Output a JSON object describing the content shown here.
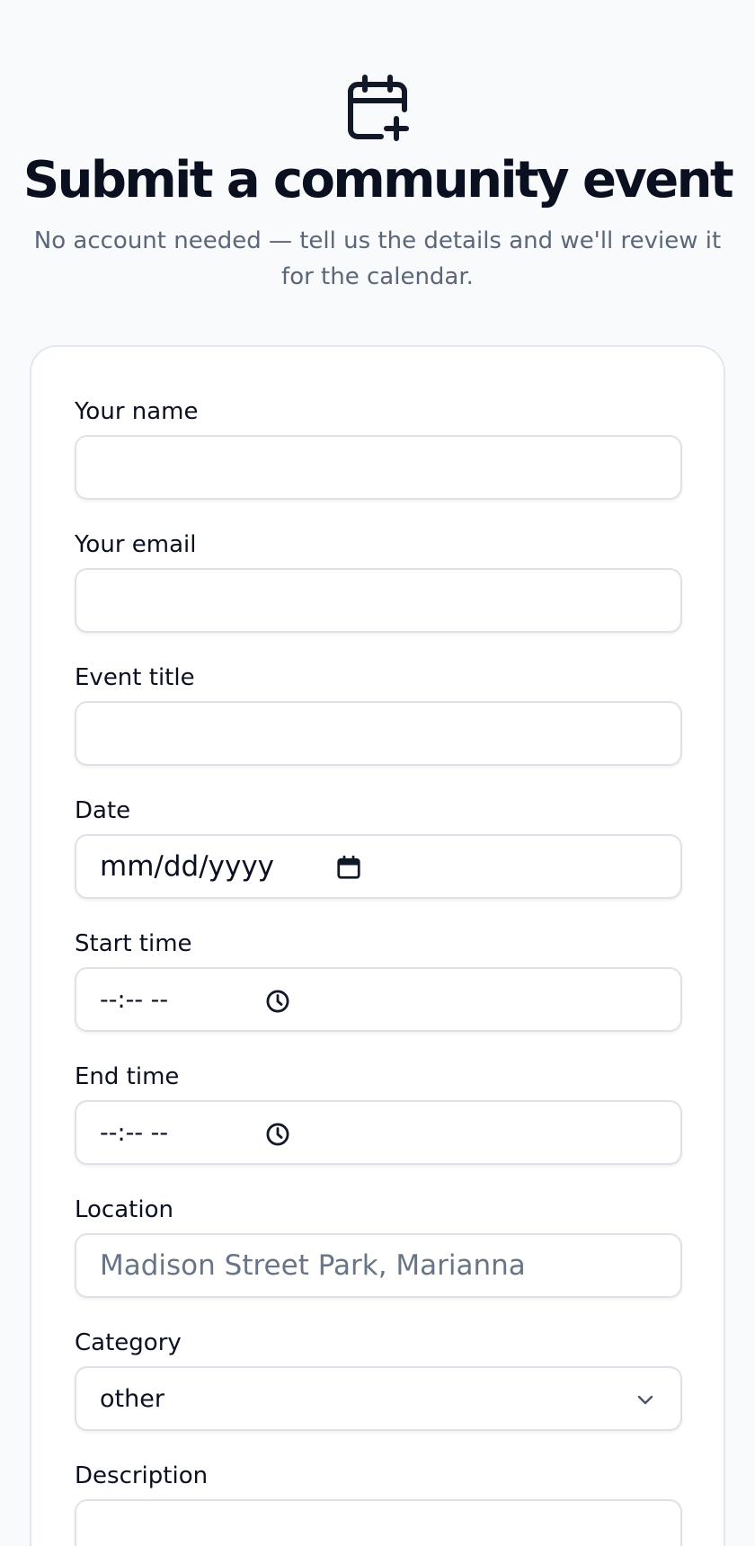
{
  "header": {
    "icon": "calendar-plus-icon",
    "title": "Submit a community event",
    "subtitle": "No account needed — tell us the details and we'll review it for the calendar."
  },
  "form": {
    "name": {
      "label": "Your name",
      "value": ""
    },
    "email": {
      "label": "Your email",
      "value": ""
    },
    "title": {
      "label": "Event title",
      "value": ""
    },
    "date": {
      "label": "Date",
      "placeholder": "mm/dd/yyyy",
      "icon": "calendar-icon"
    },
    "start_time": {
      "label": "Start time",
      "placeholder": "--:-- --",
      "icon": "clock-icon"
    },
    "end_time": {
      "label": "End time",
      "placeholder": "--:-- --",
      "icon": "clock-icon"
    },
    "location": {
      "label": "Location",
      "placeholder": "Madison Street Park, Marianna"
    },
    "category": {
      "label": "Category",
      "selected": "other",
      "icon": "chevron-down-icon"
    },
    "description": {
      "label": "Description"
    }
  },
  "colors": {
    "background": "#f8fafc",
    "text": "#0b1020",
    "muted": "#5b6779",
    "border": "#dde2e9"
  }
}
